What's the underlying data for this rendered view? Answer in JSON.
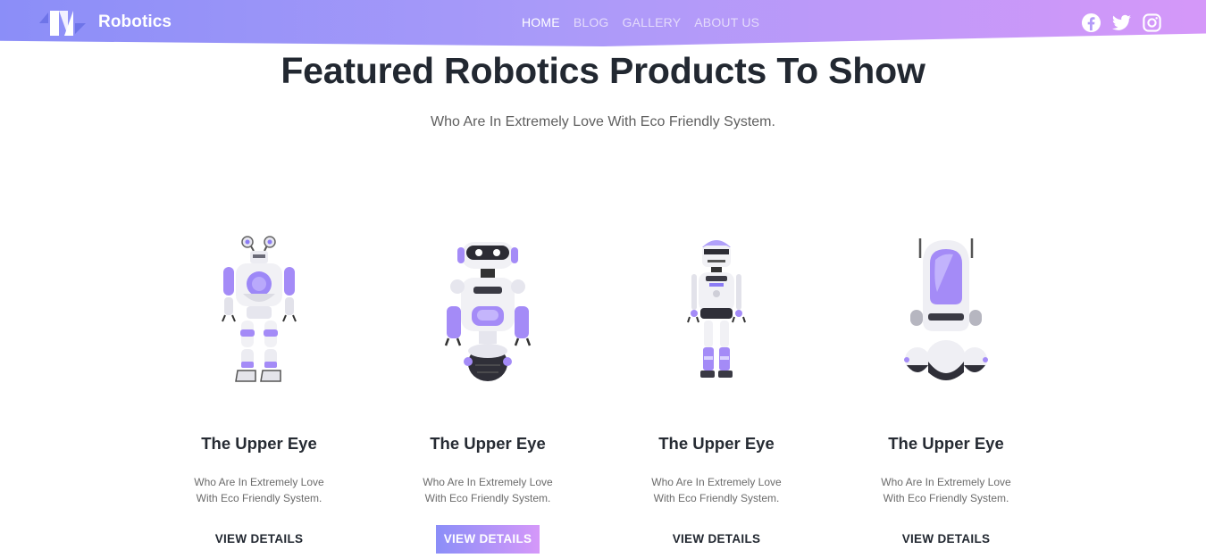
{
  "brand": {
    "name": "Robotics",
    "logo_icon": "robotics-logo-icon"
  },
  "nav": {
    "items": [
      {
        "label": "HOME",
        "active": true
      },
      {
        "label": "BLOG",
        "active": false
      },
      {
        "label": "GALLERY",
        "active": false
      },
      {
        "label": "ABOUT US",
        "active": false
      }
    ]
  },
  "social": [
    "facebook-icon",
    "twitter-icon",
    "instagram-icon"
  ],
  "hero": {
    "title": "Featured Robotics Products To Show",
    "subtitle": "Who Are In Extremely Love With Eco Friendly System."
  },
  "products": [
    {
      "title": "The Upper Eye",
      "description": "Who Are In Extremely Love With Eco Friendly System.",
      "button": "VIEW DETAILS",
      "highlighted": false
    },
    {
      "title": "The Upper Eye",
      "description": "Who Are In Extremely Love With Eco Friendly System.",
      "button": "VIEW DETAILS",
      "highlighted": true
    },
    {
      "title": "The Upper Eye",
      "description": "Who Are In Extremely Love With Eco Friendly System.",
      "button": "VIEW DETAILS",
      "highlighted": false
    },
    {
      "title": "The Upper Eye",
      "description": "Who Are In Extremely Love With Eco Friendly System.",
      "button": "VIEW DETAILS",
      "highlighted": false
    }
  ],
  "colors": {
    "gradient_start": "#8b8ef8",
    "gradient_end": "#d598f9",
    "accent_purple": "#a48bf7",
    "heading": "#222831"
  }
}
